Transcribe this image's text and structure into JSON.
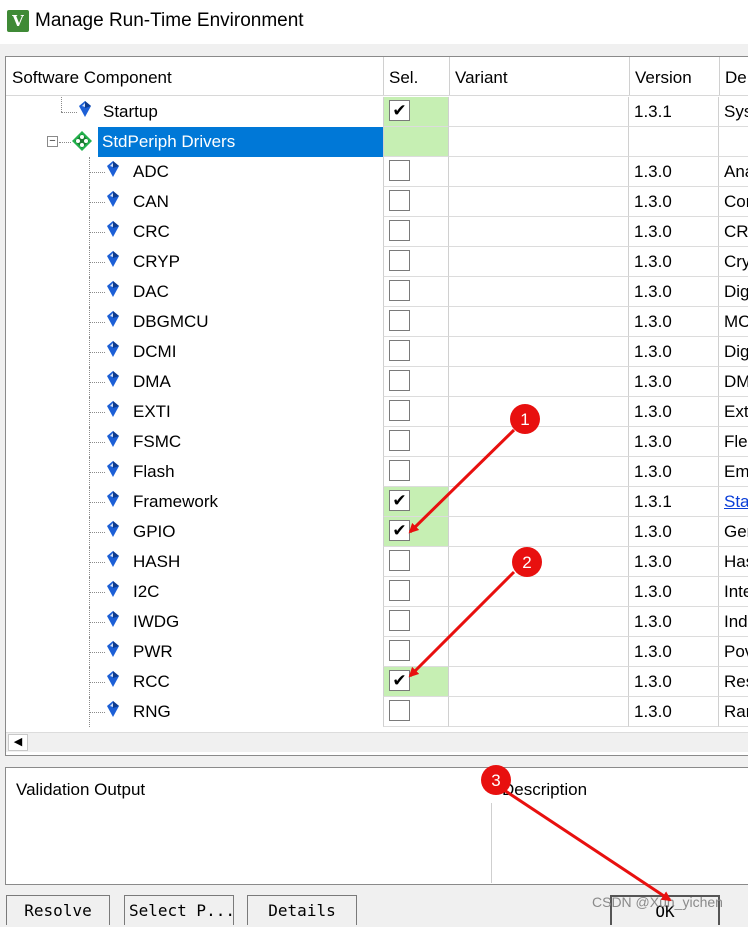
{
  "window": {
    "title": "Manage Run-Time Environment",
    "icon": "keil-uvision-icon"
  },
  "columns": {
    "component": "Software Component",
    "sel": "Sel.",
    "variant": "Variant",
    "version": "Version",
    "description": "De"
  },
  "rows": [
    {
      "label": "Startup",
      "level": 2,
      "checked": true,
      "version": "1.3.1",
      "desc": "Sys",
      "selected_green": true
    },
    {
      "label": "StdPeriph Drivers",
      "level": 1,
      "group": true,
      "highlighted": true,
      "checked": null,
      "version": "",
      "desc": "",
      "selected_green": true
    },
    {
      "label": "ADC",
      "level": 3,
      "checked": false,
      "version": "1.3.0",
      "desc": "Ana"
    },
    {
      "label": "CAN",
      "level": 3,
      "checked": false,
      "version": "1.3.0",
      "desc": "Cor"
    },
    {
      "label": "CRC",
      "level": 3,
      "checked": false,
      "version": "1.3.0",
      "desc": "CRC"
    },
    {
      "label": "CRYP",
      "level": 3,
      "checked": false,
      "version": "1.3.0",
      "desc": "Cry"
    },
    {
      "label": "DAC",
      "level": 3,
      "checked": false,
      "version": "1.3.0",
      "desc": "Dig"
    },
    {
      "label": "DBGMCU",
      "level": 3,
      "checked": false,
      "version": "1.3.0",
      "desc": "MC"
    },
    {
      "label": "DCMI",
      "level": 3,
      "checked": false,
      "version": "1.3.0",
      "desc": "Dig"
    },
    {
      "label": "DMA",
      "level": 3,
      "checked": false,
      "version": "1.3.0",
      "desc": "DM"
    },
    {
      "label": "EXTI",
      "level": 3,
      "checked": false,
      "version": "1.3.0",
      "desc": "Ext"
    },
    {
      "label": "FSMC",
      "level": 3,
      "checked": false,
      "version": "1.3.0",
      "desc": "Fle"
    },
    {
      "label": "Flash",
      "level": 3,
      "checked": false,
      "version": "1.3.0",
      "desc": "Em"
    },
    {
      "label": "Framework",
      "level": 3,
      "checked": true,
      "version": "1.3.1",
      "desc": "Sta",
      "desc_link": true,
      "selected_green": true
    },
    {
      "label": "GPIO",
      "level": 3,
      "checked": true,
      "version": "1.3.0",
      "desc": "Ger",
      "selected_green": true
    },
    {
      "label": "HASH",
      "level": 3,
      "checked": false,
      "version": "1.3.0",
      "desc": "Has"
    },
    {
      "label": "I2C",
      "level": 3,
      "checked": false,
      "version": "1.3.0",
      "desc": "Inte"
    },
    {
      "label": "IWDG",
      "level": 3,
      "checked": false,
      "version": "1.3.0",
      "desc": "Ind"
    },
    {
      "label": "PWR",
      "level": 3,
      "checked": false,
      "version": "1.3.0",
      "desc": "Pov"
    },
    {
      "label": "RCC",
      "level": 3,
      "checked": true,
      "version": "1.3.0",
      "desc": "Res",
      "selected_green": true
    },
    {
      "label": "RNG",
      "level": 3,
      "checked": false,
      "version": "1.3.0",
      "desc": "Ran"
    }
  ],
  "bottom": {
    "validation_label": "Validation Output",
    "description_label": "Description"
  },
  "buttons": {
    "resolve": "Resolve",
    "select_packs": "Select P...",
    "details": "Details",
    "ok": "OK"
  },
  "annotations": [
    "1",
    "2",
    "3"
  ],
  "watermark": "CSDN @Xun_yichen",
  "colors": {
    "selection_green": "#c6efb3",
    "highlight_blue": "#0078d7",
    "annotation_red": "#e8100f",
    "component_icon_blue": "#1c5fd6",
    "group_icon_green": "#22b14c"
  }
}
